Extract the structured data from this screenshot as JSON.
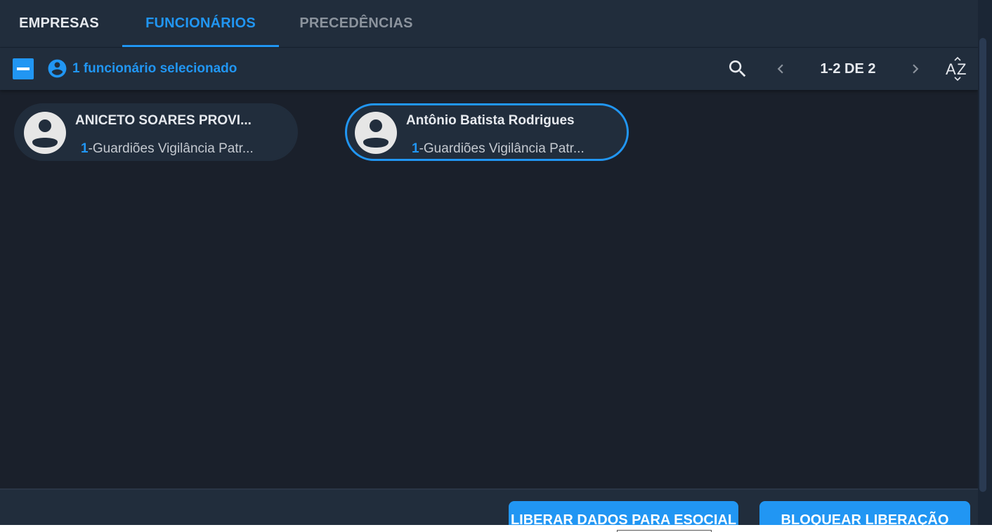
{
  "tabs": [
    {
      "label": "EMPRESAS",
      "state": "inactive"
    },
    {
      "label": "FUNCIONÁRIOS",
      "state": "active"
    },
    {
      "label": "PRECEDÊNCIAS",
      "state": "disabled"
    }
  ],
  "toolbar": {
    "selection_text": "1 funcionário selecionado",
    "pager_text": "1-2 DE 2",
    "icons": {
      "select_all": "minus-checkbox-icon",
      "selection": "account-circle-icon",
      "search": "search-icon",
      "prev": "chevron-left-icon",
      "next": "chevron-right-icon",
      "sort": "sort-alphabetical-icon"
    }
  },
  "employees": [
    {
      "name": "ANICETO SOARES PROVI...",
      "company_code": "1",
      "company_name": "-Guardiões Vigilância Patr...",
      "selected": false
    },
    {
      "name": "Antônio Batista Rodrigues",
      "company_code": "1",
      "company_name": "-Guardiões Vigilância Patr...",
      "selected": true
    }
  ],
  "footer": {
    "liberar_label": "LIBERAR DADOS PARA ESOCIAL",
    "bloquear_label": "BLOQUEAR LIBERAÇÃO"
  },
  "colors": {
    "accent": "#2196f3",
    "background": "#1a202b",
    "surface": "#212d3c",
    "text": "#e6e9ee",
    "muted_text": "#8b939d"
  }
}
